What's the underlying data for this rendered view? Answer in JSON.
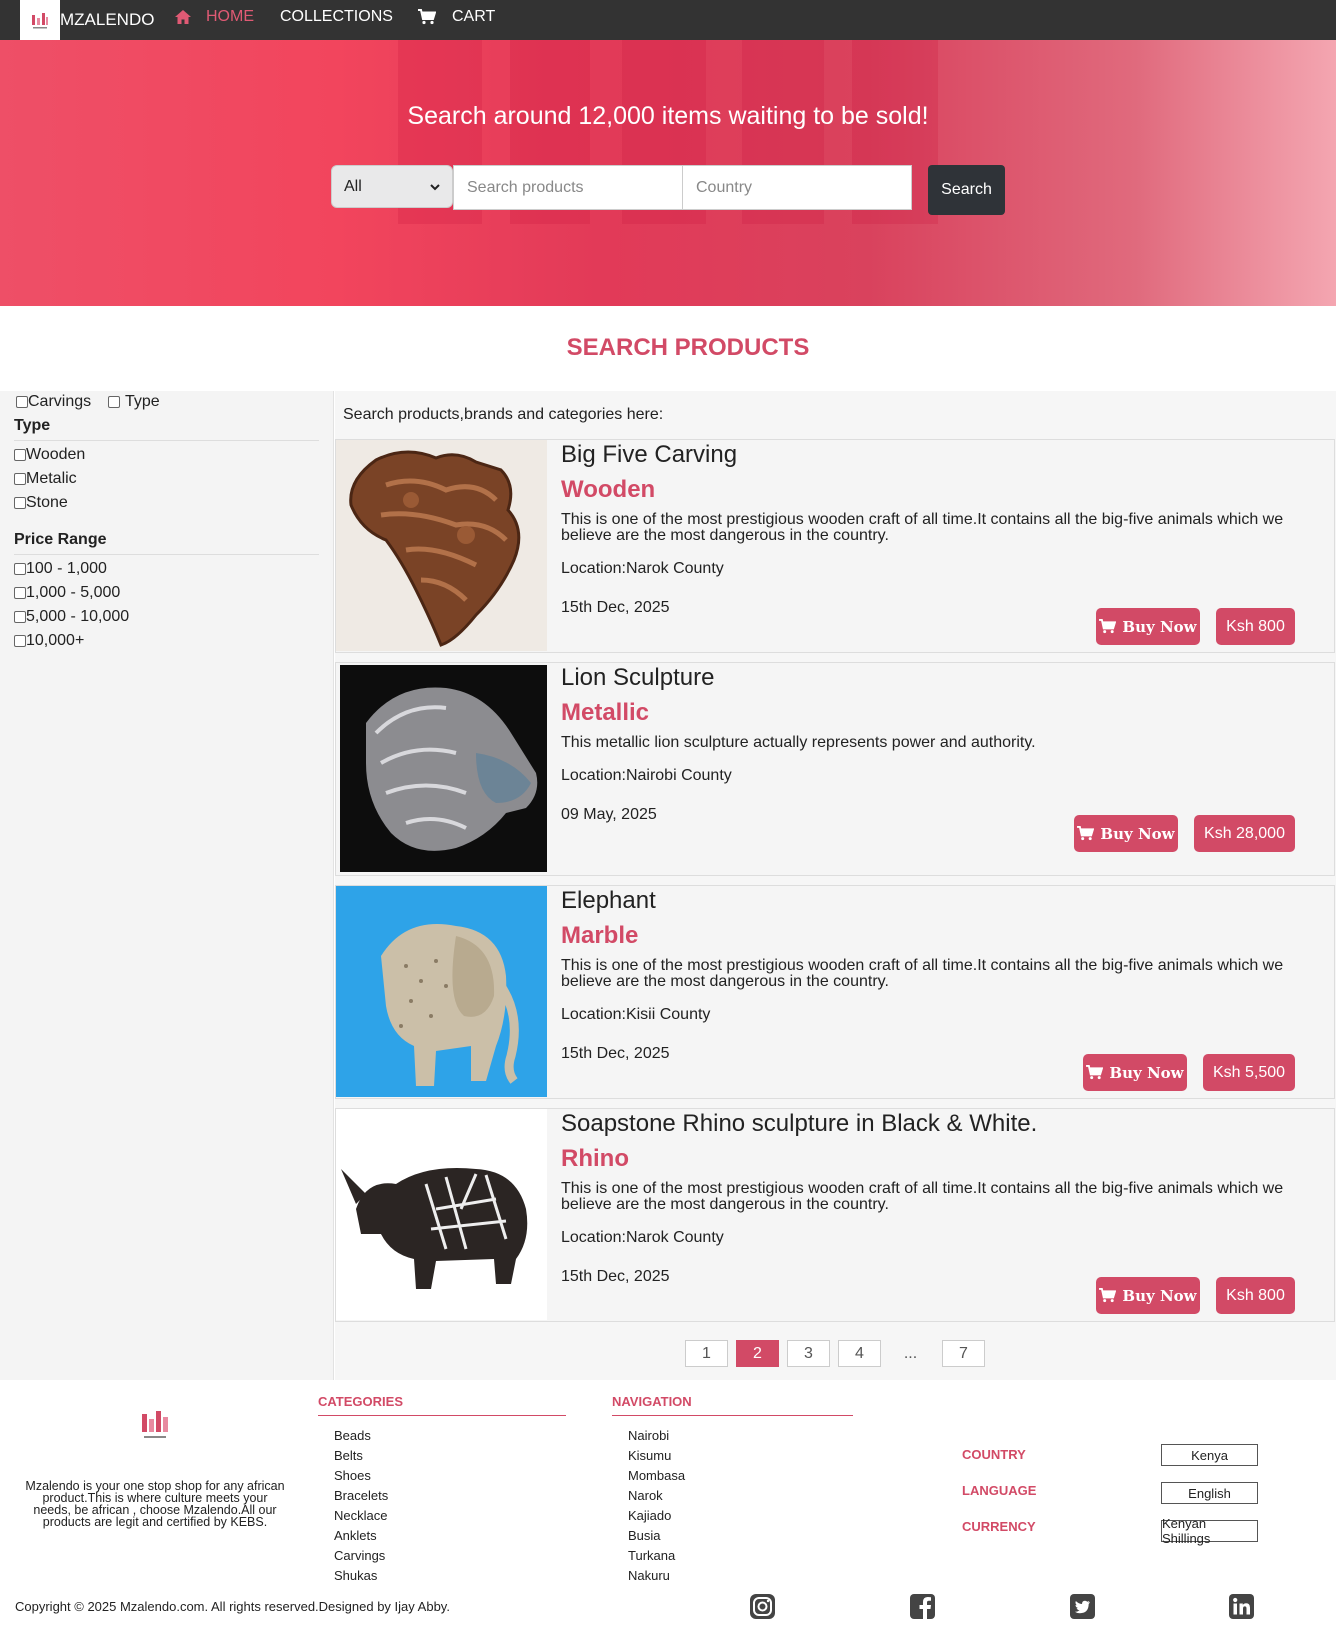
{
  "nav": {
    "brand": "MZALENDO",
    "items": [
      {
        "label": "HOME",
        "icon": "home-icon",
        "active": true
      },
      {
        "label": "COLLECTIONS",
        "icon": "",
        "active": false
      },
      {
        "label": "CART",
        "icon": "cart-icon",
        "active": false
      }
    ]
  },
  "hero": {
    "title": "Search around 12,000 items waiting to be sold!",
    "select_value": "All",
    "search_placeholder": "Search products",
    "country_placeholder": "Country",
    "button": "Search"
  },
  "section_title": "SEARCH PRODUCTS",
  "sidebar": {
    "top_checks": [
      "Carvings",
      "Type"
    ],
    "type_heading": "Type",
    "types": [
      "Wooden",
      "Metalic",
      "Stone"
    ],
    "price_heading": "Price Range",
    "prices": [
      "100 - 1,000",
      "1,000 - 5,000",
      "5,000 - 10,000",
      "10,000+"
    ]
  },
  "main": {
    "intro": "Search products,brands and categories here:",
    "products": [
      {
        "title": "Big Five Carving",
        "category": "Wooden",
        "description": "This is one of the most prestigious wooden craft of all time.It contains all the big-five animals which we believe are the most dangerous in the country.",
        "location": "Location:Narok County",
        "date": "15th Dec, 2025",
        "buy": "Buy Now",
        "price": "Ksh 800"
      },
      {
        "title": "Lion Sculpture",
        "category": "Metallic",
        "description": "This metallic lion sculpture actually represents power and authority.",
        "location": "Location:Nairobi County",
        "date": "09 May, 2025",
        "buy": "Buy Now",
        "price": "Ksh 28,000"
      },
      {
        "title": "Elephant",
        "category": "Marble",
        "description": "This is one of the most prestigious wooden craft of all time.It contains all the big-five animals which we believe are the most dangerous in the country.",
        "location": "Location:Kisii County",
        "date": "15th Dec, 2025",
        "buy": "Buy Now",
        "price": "Ksh 5,500"
      },
      {
        "title": "Soapstone Rhino sculpture in Black & White.",
        "category": "Rhino",
        "description": "This is one of the most prestigious wooden craft of all time.It contains all the big-five animals which we believe are the most dangerous in the country.",
        "location": "Location:Narok County",
        "date": "15th Dec, 2025",
        "buy": "Buy Now",
        "price": "Ksh 800"
      }
    ],
    "pagination": [
      "1",
      "2",
      "3",
      "4",
      "...",
      "7"
    ],
    "current_page": "2"
  },
  "footer": {
    "about": "Mzalendo is your one stop shop for any african product.This is where culture meets your needs, be african , choose Mzalendo.All our products are legit and certified by KEBS.",
    "categories_heading": "CATEGORIES",
    "categories": [
      "Beads",
      "Belts",
      "Shoes",
      "Bracelets",
      "Necklace",
      "Anklets",
      "Carvings",
      "Shukas"
    ],
    "navigation_heading": "NAVIGATION",
    "navigation": [
      "Nairobi",
      "Kisumu",
      "Mombasa",
      "Narok",
      "Kajiado",
      "Busia",
      "Turkana",
      "Nakuru"
    ],
    "country_label": "COUNTRY",
    "country_value": "Kenya",
    "language_label": "LANGUAGE",
    "language_value": "English",
    "currency_label": "CURRENCY",
    "currency_value": "Kenyan Shillings",
    "copyright": "Copyright © 2025 Mzalendo.com. All rights reserved.Designed by Ijay Abby.",
    "social_icons": [
      "instagram-icon",
      "facebook-icon",
      "twitter-icon",
      "linkedin-icon"
    ]
  },
  "colors": {
    "accent": "#d24a66",
    "navbar": "#333333",
    "dark_button": "#2f3338"
  }
}
